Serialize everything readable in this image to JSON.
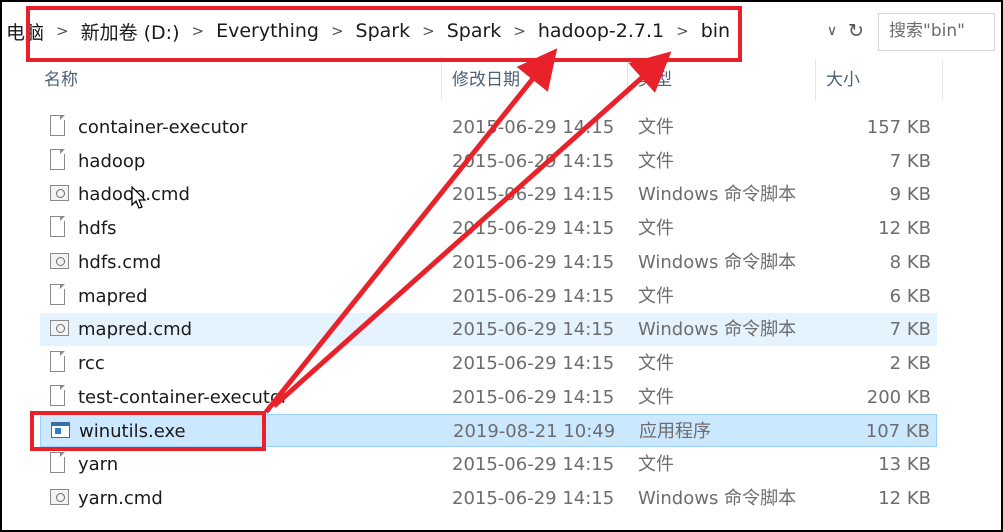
{
  "address": {
    "crumbs": [
      "电脑",
      "新加卷 (D:)",
      "Everything",
      "Spark",
      "Spark",
      "hadoop-2.7.1",
      "bin"
    ],
    "search_placeholder": "搜索\"bin\""
  },
  "columns": {
    "name": "名称",
    "date": "修改日期",
    "type": "类型",
    "size": "大小"
  },
  "files": [
    {
      "name": "container-executor",
      "date": "2015-06-29 14:15",
      "type": "文件",
      "size": "157 KB",
      "icon": "file-icon"
    },
    {
      "name": "hadoop",
      "date": "2015-06-29 14:15",
      "type": "文件",
      "size": "7 KB",
      "icon": "file-icon"
    },
    {
      "name": "hadoop.cmd",
      "date": "2015-06-29 14:15",
      "type": "Windows 命令脚本",
      "size": "9 KB",
      "icon": "cmd-icon"
    },
    {
      "name": "hdfs",
      "date": "2015-06-29 14:15",
      "type": "文件",
      "size": "12 KB",
      "icon": "file-icon"
    },
    {
      "name": "hdfs.cmd",
      "date": "2015-06-29 14:15",
      "type": "Windows 命令脚本",
      "size": "8 KB",
      "icon": "cmd-icon"
    },
    {
      "name": "mapred",
      "date": "2015-06-29 14:15",
      "type": "文件",
      "size": "6 KB",
      "icon": "file-icon"
    },
    {
      "name": "mapred.cmd",
      "date": "2015-06-29 14:15",
      "type": "Windows 命令脚本",
      "size": "7 KB",
      "icon": "cmd-icon"
    },
    {
      "name": "rcc",
      "date": "2015-06-29 14:15",
      "type": "文件",
      "size": "2 KB",
      "icon": "file-icon"
    },
    {
      "name": "test-container-executor",
      "date": "2015-06-29 14:15",
      "type": "文件",
      "size": "200 KB",
      "icon": "file-icon"
    },
    {
      "name": "winutils.exe",
      "date": "2019-08-21 10:49",
      "type": "应用程序",
      "size": "107 KB",
      "icon": "exe-icon"
    },
    {
      "name": "yarn",
      "date": "2015-06-29 14:15",
      "type": "文件",
      "size": "13 KB",
      "icon": "file-icon"
    },
    {
      "name": "yarn.cmd",
      "date": "2015-06-29 14:15",
      "type": "Windows 命令脚本",
      "size": "12 KB",
      "icon": "cmd-icon"
    }
  ],
  "states": {
    "hover_row": 6,
    "selected_row": 9
  },
  "colors": {
    "annotation": "#e8212a",
    "selection": "#cce8ff",
    "hover": "#e5f3ff"
  }
}
